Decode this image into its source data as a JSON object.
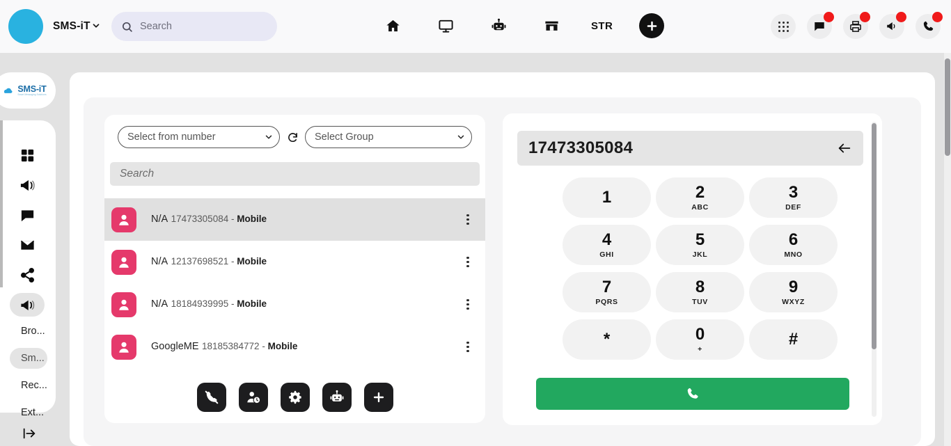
{
  "topbar": {
    "brand": "SMS-iT",
    "brand_caret_icon": "chevron-down-icon",
    "search": {
      "value": "",
      "placeholder": "Search",
      "icon": "search-icon"
    },
    "nav_center": [
      {
        "name": "home",
        "icon": "home-icon",
        "label": ""
      },
      {
        "name": "monitor",
        "icon": "monitor-icon",
        "label": ""
      },
      {
        "name": "robot",
        "icon": "robot-icon",
        "label": ""
      },
      {
        "name": "store",
        "icon": "store-icon",
        "label": ""
      },
      {
        "name": "str",
        "icon": "text-icon",
        "label": "STR"
      }
    ],
    "add_button": {
      "label": "+",
      "icon": "plus-icon"
    },
    "nav_right": [
      {
        "name": "apps",
        "icon": "grid-dots-icon",
        "badge": false
      },
      {
        "name": "messages",
        "icon": "chat-bubble-icon",
        "badge": true
      },
      {
        "name": "print",
        "icon": "printer-icon",
        "badge": true
      },
      {
        "name": "announcements",
        "icon": "megaphone-icon",
        "badge": true
      },
      {
        "name": "calls",
        "icon": "phone-icon",
        "badge": true
      }
    ]
  },
  "logo": {
    "text": "SMS-iT",
    "tagline": "Smart Messaging Solutions",
    "icon": "cloud-icon"
  },
  "sidebar": {
    "icons": [
      {
        "name": "dashboard",
        "icon": "grid-squares-icon",
        "active": false
      },
      {
        "name": "campaigns",
        "icon": "megaphone-icon",
        "active": false
      },
      {
        "name": "chat",
        "icon": "chat-bubble-icon",
        "active": false
      },
      {
        "name": "email",
        "icon": "envelope-icon",
        "active": false
      },
      {
        "name": "share",
        "icon": "share-icon",
        "active": false
      },
      {
        "name": "broadcast",
        "icon": "megaphone-filled-icon",
        "active": true
      }
    ],
    "sub_items": [
      {
        "label": "Bro...",
        "active": false
      },
      {
        "label": "Sm...",
        "active": true
      },
      {
        "label": "Rec...",
        "active": false
      },
      {
        "label": "Ext...",
        "active": false
      }
    ],
    "collapse_icon": "collapse-panel-icon"
  },
  "contacts_panel": {
    "from_number_select": {
      "value": "Select from number",
      "options": [
        "Select from number"
      ]
    },
    "refresh_icon": "refresh-icon",
    "group_select": {
      "value": "Select Group",
      "options": [
        "Select Group"
      ]
    },
    "search": {
      "value": "",
      "placeholder": "Search"
    },
    "rows": [
      {
        "name": "N/A",
        "number": "17473305084",
        "type": "Mobile",
        "selected": true
      },
      {
        "name": "N/A",
        "number": "12137698521",
        "type": "Mobile",
        "selected": false
      },
      {
        "name": "N/A",
        "number": "18184939995",
        "type": "Mobile",
        "selected": false
      },
      {
        "name": "GoogleME",
        "number": "18185384772",
        "type": "Mobile",
        "selected": false
      }
    ],
    "separator": "-",
    "actions": [
      {
        "name": "end-call",
        "icon": "phone-slash-icon"
      },
      {
        "name": "recent-contacts",
        "icon": "person-clock-icon"
      },
      {
        "name": "settings",
        "icon": "gear-icon"
      },
      {
        "name": "ai-assistant",
        "icon": "robot-icon"
      },
      {
        "name": "add-contact",
        "icon": "plus-icon"
      }
    ]
  },
  "dialer": {
    "number": "17473305084",
    "backspace_icon": "backspace-arrow-icon",
    "keys": [
      {
        "digit": "1",
        "letters": ""
      },
      {
        "digit": "2",
        "letters": "ABC"
      },
      {
        "digit": "3",
        "letters": "DEF"
      },
      {
        "digit": "4",
        "letters": "GHI"
      },
      {
        "digit": "5",
        "letters": "JKL"
      },
      {
        "digit": "6",
        "letters": "MNO"
      },
      {
        "digit": "7",
        "letters": "PQRS"
      },
      {
        "digit": "8",
        "letters": "TUV"
      },
      {
        "digit": "9",
        "letters": "WXYZ"
      },
      {
        "digit": "*",
        "letters": ""
      },
      {
        "digit": "0",
        "letters": "+"
      },
      {
        "digit": "#",
        "letters": ""
      }
    ],
    "call_button": {
      "icon": "phone-icon",
      "color": "#22a85f"
    }
  },
  "colors": {
    "brand_blue": "#29b2e0",
    "avatar_pink": "#e5396b",
    "call_green": "#22a85f",
    "badge_red": "#f01a1a",
    "page_bg": "#e2e2e2"
  }
}
